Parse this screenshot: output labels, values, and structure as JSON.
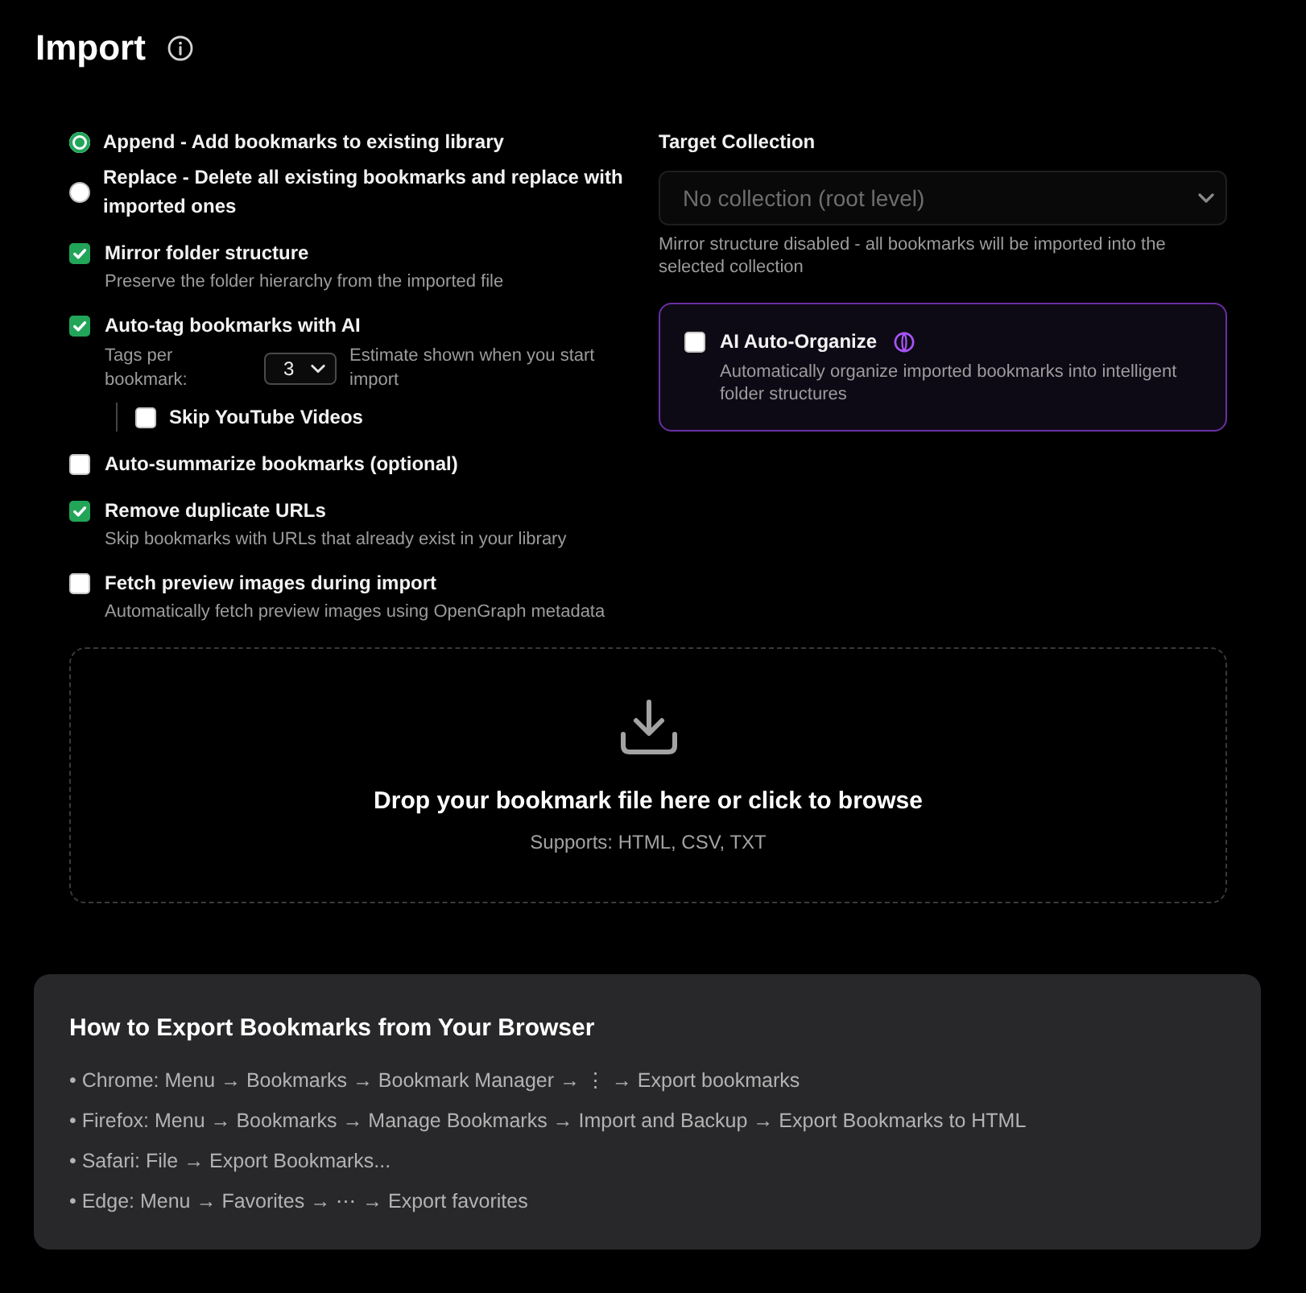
{
  "header": {
    "title": "Import"
  },
  "import_mode": [
    {
      "label": "Append - Add bookmarks to existing library",
      "selected": true
    },
    {
      "label": "Replace - Delete all existing bookmarks and replace with imported ones",
      "selected": false
    }
  ],
  "options": [
    {
      "label": "Mirror folder structure",
      "checked": true,
      "description": "Preserve the folder hierarchy from the imported file"
    },
    {
      "label": "Auto-tag bookmarks with AI",
      "checked": true,
      "tags_per_bookmark": {
        "label": "Tags per bookmark:",
        "value": "3",
        "note": "Estimate shown when you start import"
      },
      "sub_options": [
        {
          "label": "Skip YouTube Videos",
          "checked": false
        }
      ]
    },
    {
      "label": "Auto-summarize bookmarks (optional)",
      "checked": false
    },
    {
      "label": "Remove duplicate URLs",
      "checked": true,
      "description": "Skip bookmarks with URLs that already exist in your library"
    },
    {
      "label": "Fetch preview images during import",
      "checked": false,
      "description": "Automatically fetch preview images using OpenGraph metadata"
    }
  ],
  "target_collection": {
    "label": "Target Collection",
    "value": "No collection (root level)",
    "disabled": true,
    "help": "Mirror structure disabled - all bookmarks will be imported into the selected collection"
  },
  "ai_organize": {
    "label": "AI Auto-Organize",
    "checked": false,
    "description": "Automatically organize imported bookmarks into intelligent folder structures"
  },
  "dropzone": {
    "title": "Drop your bookmark file here or click to browse",
    "formats": "Supports: HTML, CSV, TXT"
  },
  "export_help": {
    "title": "How to Export Bookmarks from Your Browser",
    "steps": [
      "• Chrome: Menu → Bookmarks → Bookmark Manager → ⋮ → Export bookmarks",
      "• Firefox: Menu → Bookmarks → Manage Bookmarks → Import and Backup → Export Bookmarks to HTML",
      "• Safari: File → Export Bookmarks...",
      "• Edge: Menu → Favorites → ⋯ → Export favorites"
    ]
  }
}
